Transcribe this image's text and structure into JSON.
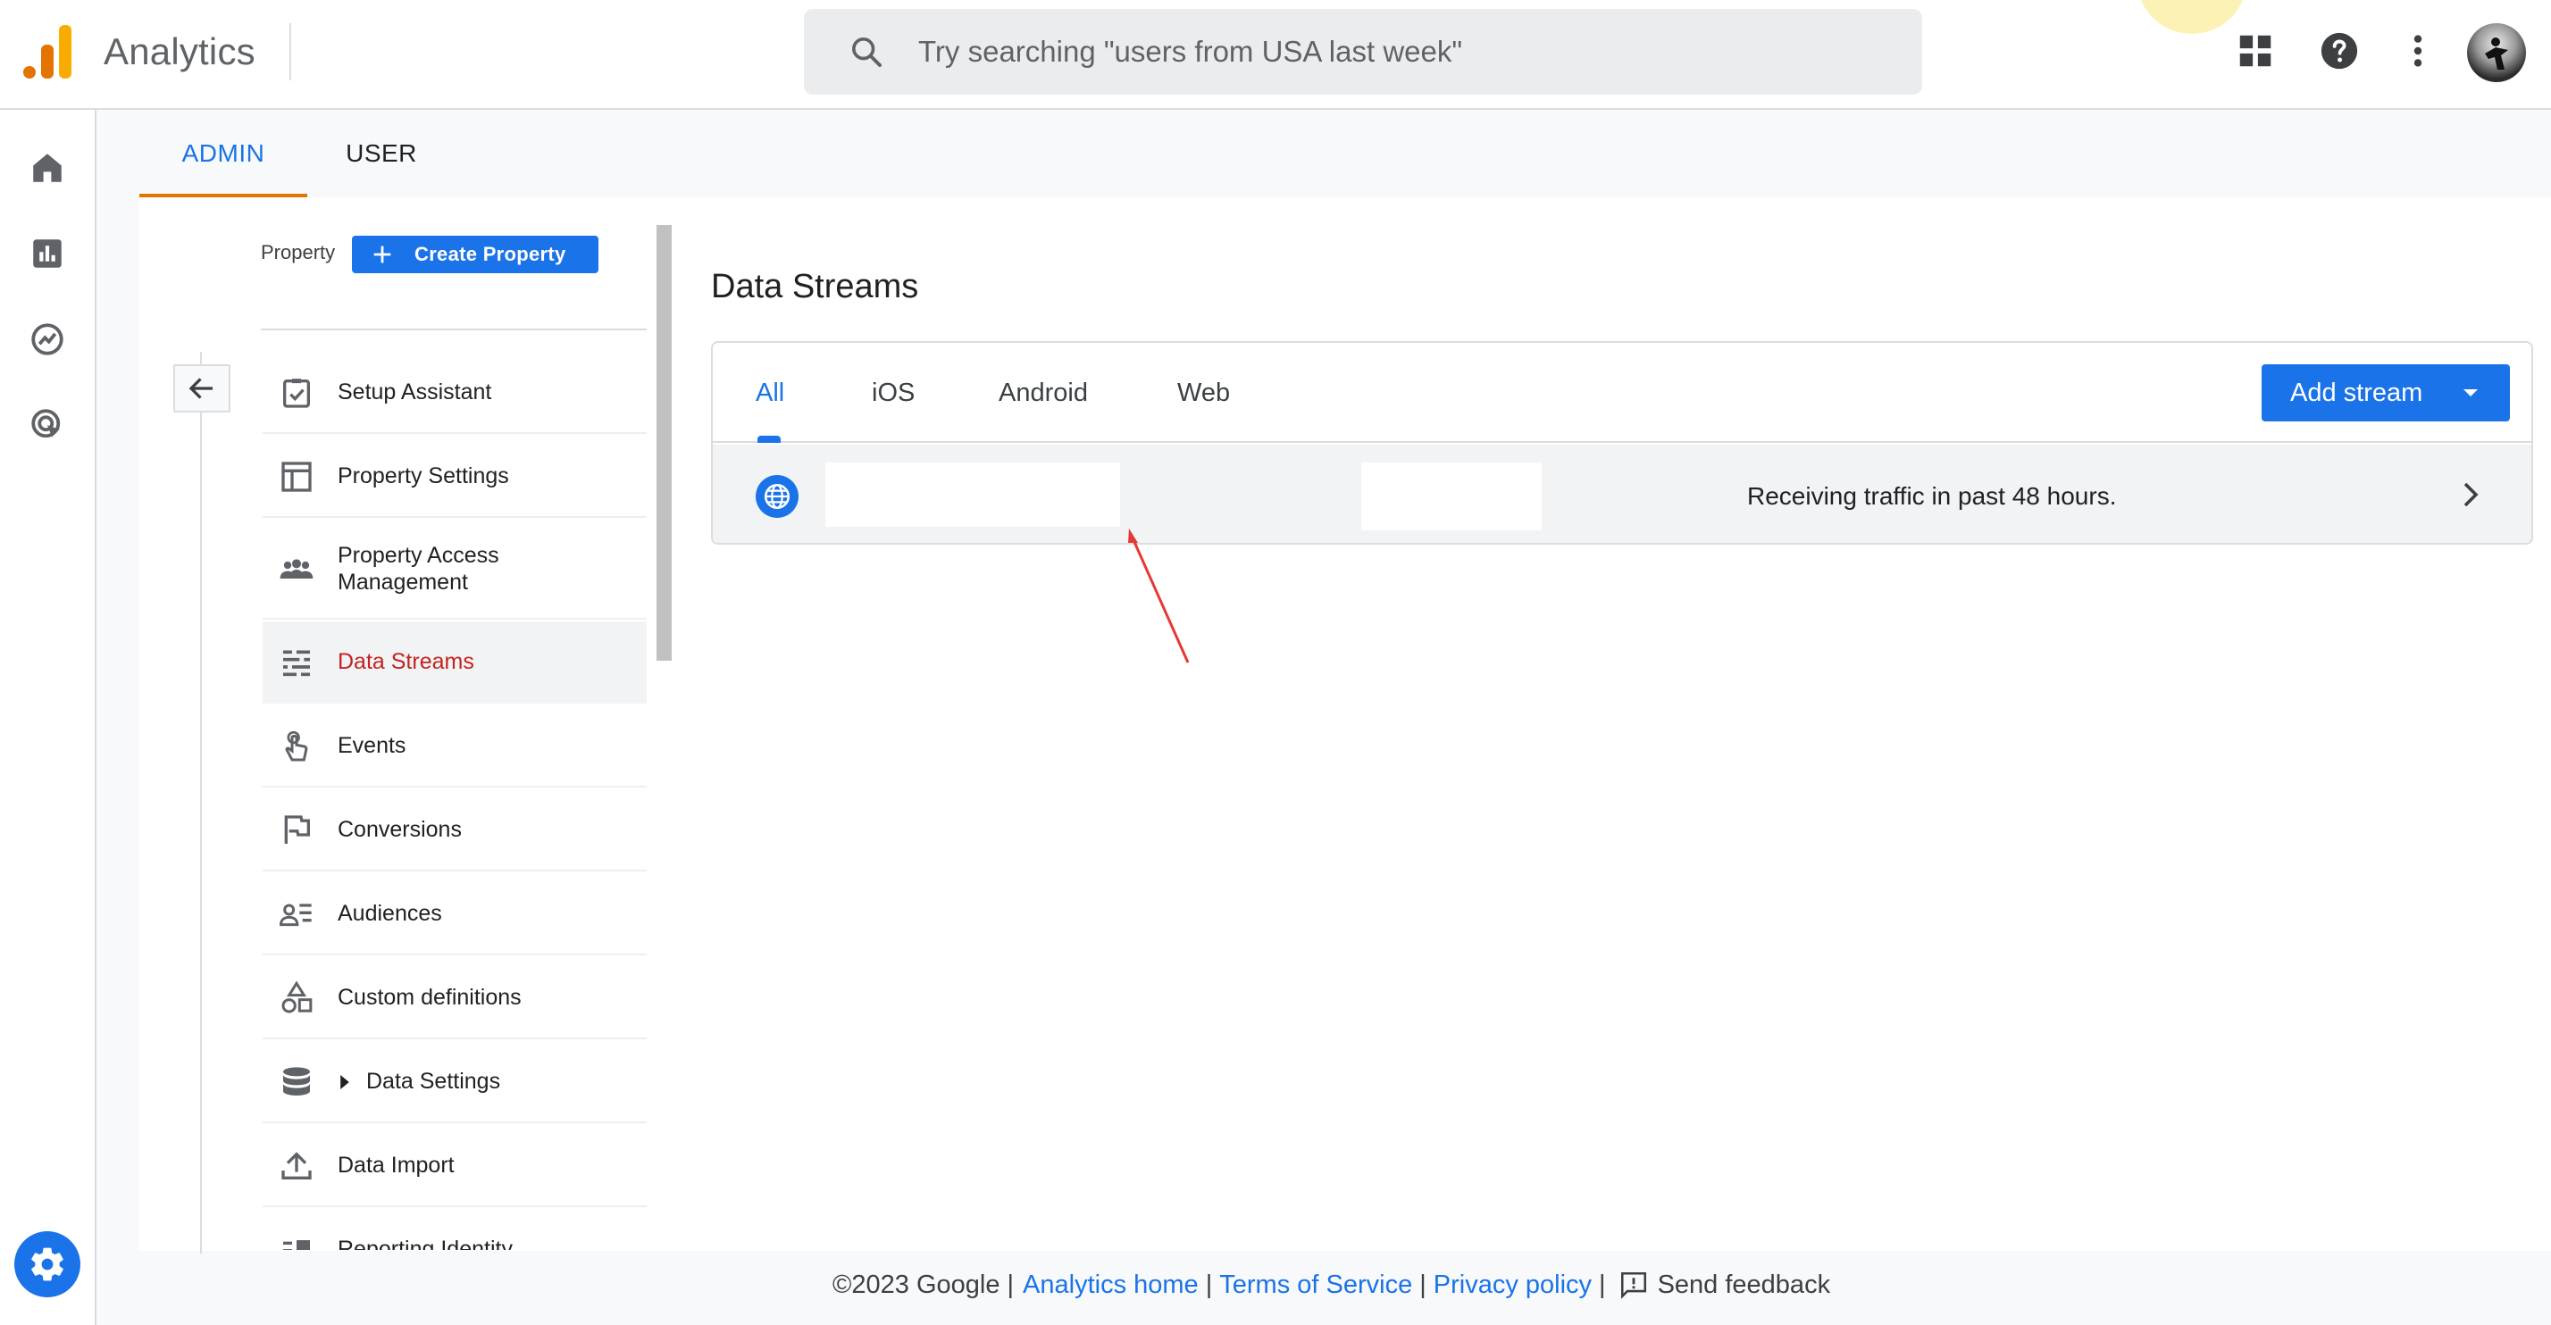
{
  "app": {
    "title": "Analytics"
  },
  "search": {
    "placeholder": "Try searching \"users from USA last week\""
  },
  "header_icons": [
    "apps-grid-icon",
    "help-icon",
    "more-vert-icon",
    "account-avatar"
  ],
  "rail": {
    "items": [
      "home-icon",
      "reports-icon",
      "explore-icon",
      "advertising-icon"
    ],
    "settings": "admin-gear-icon"
  },
  "admin_tabs": [
    {
      "label": "ADMIN",
      "active": true
    },
    {
      "label": "USER",
      "active": false
    }
  ],
  "property": {
    "label": "Property",
    "create_label": "Create Property"
  },
  "nav": {
    "items": [
      {
        "label": "Setup Assistant",
        "icon": "checklist-icon"
      },
      {
        "label": "Property Settings",
        "icon": "web-layout-icon"
      },
      {
        "label": "Property Access Management",
        "icon": "people-icon"
      },
      {
        "label": "Data Streams",
        "icon": "streams-icon",
        "active": true
      },
      {
        "label": "Events",
        "icon": "touch-icon"
      },
      {
        "label": "Conversions",
        "icon": "flag-icon"
      },
      {
        "label": "Audiences",
        "icon": "audience-icon"
      },
      {
        "label": "Custom definitions",
        "icon": "shapes-icon"
      },
      {
        "label": "Data Settings",
        "icon": "database-icon"
      },
      {
        "label": "Data Import",
        "icon": "upload-icon"
      },
      {
        "label": "Reporting Identity",
        "icon": "identity-icon"
      }
    ]
  },
  "data_streams": {
    "title": "Data Streams",
    "tabs": [
      {
        "label": "All",
        "active": true
      },
      {
        "label": "iOS"
      },
      {
        "label": "Android"
      },
      {
        "label": "Web"
      }
    ],
    "add_stream_label": "Add stream",
    "row": {
      "status": "Receiving traffic in past 48 hours."
    }
  },
  "footer": {
    "copyright": "©2023 Google |",
    "analytics_home": "Analytics home",
    "sep": "|",
    "terms": "Terms of Service",
    "privacy": "Privacy policy",
    "feedback": "Send feedback"
  },
  "colors": {
    "accent_blue": "#1a73e8",
    "active_red": "#c5221f",
    "tab_underline_orange": "#e37400",
    "annotation_arrow": "#e53935"
  }
}
